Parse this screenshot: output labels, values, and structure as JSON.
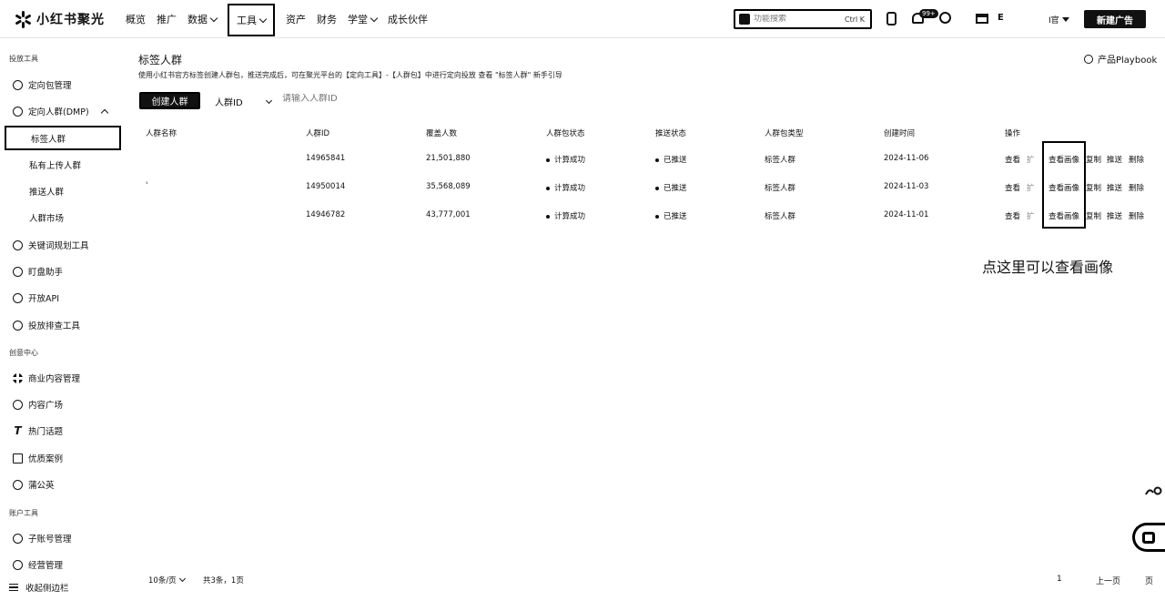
{
  "header": {
    "brand": "小红书聚光",
    "nav": [
      {
        "label": "概览",
        "has_dropdown": false
      },
      {
        "label": "推广",
        "has_dropdown": false
      },
      {
        "label": "数据",
        "has_dropdown": true
      },
      {
        "label": "工具",
        "has_dropdown": true,
        "highlighted": true
      },
      {
        "label": "资产",
        "has_dropdown": false
      },
      {
        "label": "财务",
        "has_dropdown": false
      },
      {
        "label": "学堂",
        "has_dropdown": true
      },
      {
        "label": "成长伙伴",
        "has_dropdown": false
      }
    ],
    "search_placeholder": "功能搜索",
    "search_shortcut": "Ctrl K",
    "notification_badge": "99+",
    "account_name": "E",
    "account_sub": "I官",
    "new_button": "新建广告"
  },
  "sidebar": {
    "sections": [
      {
        "title": "投放工具"
      },
      {
        "title": "创意中心"
      },
      {
        "title": "账户工具"
      }
    ],
    "items": [
      {
        "label": "定向包管理",
        "icon": "hexagon-icon"
      },
      {
        "label": "定向人群(DMP)",
        "icon": "hexagon-icon",
        "expanded": true
      },
      {
        "label": "关键词规划工具",
        "icon": "hexagon-icon"
      },
      {
        "label": "盯盘助手",
        "icon": "shield-icon"
      },
      {
        "label": "开放API",
        "icon": "hexagon-icon"
      },
      {
        "label": "投放排查工具",
        "icon": "hexagon-icon"
      },
      {
        "label": "商业内容管理",
        "icon": "grid-icon"
      },
      {
        "label": "内容广场",
        "icon": "planet-icon"
      },
      {
        "label": "热门话题",
        "icon": "text-icon"
      },
      {
        "label": "优质案例",
        "icon": "book-icon"
      },
      {
        "label": "蒲公英",
        "icon": "hexagon-icon"
      },
      {
        "label": "子账号管理",
        "icon": "hexagon-icon"
      },
      {
        "label": "经营管理",
        "icon": "hexagon-icon"
      }
    ],
    "subitems": [
      {
        "label": "标签人群",
        "active": true
      },
      {
        "label": "私有上传人群"
      },
      {
        "label": "推送人群"
      },
      {
        "label": "人群市场"
      }
    ],
    "collapse_label": "收起侧边栏"
  },
  "main": {
    "title": "标签人群",
    "description": "使用小红书官方标签创建人群包，推送完成后，可在聚光平台的【定向工具】-【人群包】中进行定向投放    查看 \"标签人群\" 新手引导",
    "playbook": "产品Playbook",
    "create_button": "创建人群",
    "filter_field": "人群ID",
    "filter_placeholder": "请输入人群ID",
    "columns": [
      "人群名称",
      "人群ID",
      "覆盖人数",
      "人群包状态",
      "推送状态",
      "人群包类型",
      "创建时间",
      "操作"
    ],
    "rows": [
      {
        "name": "",
        "id": "14965841",
        "coverage": "21,501,880",
        "calc_status": "计算成功",
        "push_status": "已推送",
        "type": "标签人群",
        "created": "2024-11-06"
      },
      {
        "name": "'",
        "id": "14950014",
        "coverage": "35,568,089",
        "calc_status": "计算成功",
        "push_status": "已推送",
        "type": "标签人群",
        "created": "2024-11-03"
      },
      {
        "name": "",
        "id": "14946782",
        "coverage": "43,777,001",
        "calc_status": "计算成功",
        "push_status": "已推送",
        "type": "标签人群",
        "created": "2024-11-01"
      }
    ],
    "row_actions": [
      "查看",
      "扩",
      "查看画像",
      "复制",
      "推送",
      "删除"
    ],
    "annotation": "点这里可以查看画像",
    "pagination": {
      "page_size": "10条/页",
      "total": "共3条，1页",
      "current": "1",
      "prev": "上一页",
      "next": "页"
    }
  }
}
